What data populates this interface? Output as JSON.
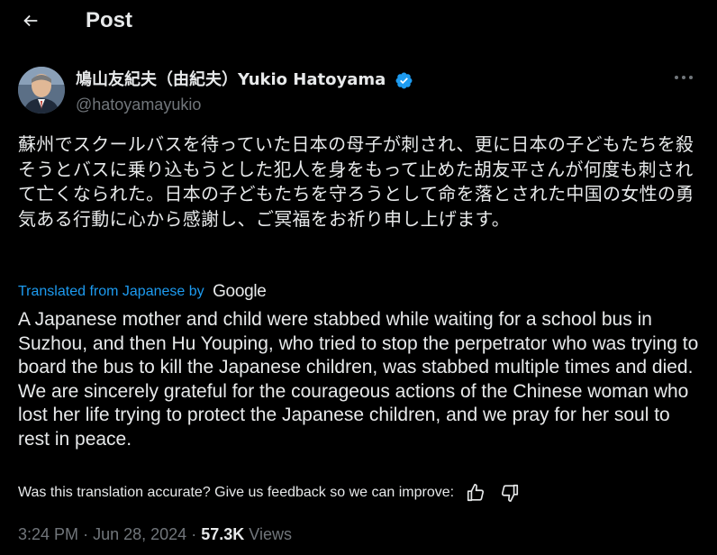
{
  "header": {
    "title": "Post"
  },
  "author": {
    "display_name": "鳩山友紀夫（由紀夫）Yukio Hatoyama",
    "handle": "@hatoyamayukio",
    "verified": true
  },
  "post": {
    "text_original": "蘇州でスクールバスを待っていた日本の母子が刺され、更に日本の子どもたちを殺そうとバスに乗り込もうとした犯人を身をもって止めた胡友平さんが何度も刺されて亡くなられた。日本の子どもたちを守ろうとして命を落とされた中国の女性の勇気ある行動に心から感謝し、ご冥福をお祈り申し上げます。",
    "translation_label": "Translated from Japanese by",
    "translation_provider": "Google",
    "text_translated": "A Japanese mother and child were stabbed while waiting for a school bus in Suzhou, and then Hu Youping, who tried to stop the perpetrator who was trying to board the bus to kill the Japanese children, was stabbed multiple times and died. We are sincerely grateful for the courageous actions of the Chinese woman who lost her life trying to protect the Japanese children, and we pray for her soul to rest in peace.",
    "feedback_prompt": "Was this translation accurate? Give us feedback so we can improve:"
  },
  "meta": {
    "time": "3:24 PM",
    "separator": "·",
    "date": "Jun 28, 2024",
    "views_count": "57.3K",
    "views_label": "Views"
  },
  "icons": {
    "back": "arrow-left-icon",
    "more": "more-horizontal-icon",
    "verified": "verified-badge-icon",
    "thumbs_up": "thumbs-up-icon",
    "thumbs_down": "thumbs-down-icon"
  },
  "colors": {
    "background": "#000000",
    "text_primary": "#e7e9ea",
    "text_secondary": "#71767b",
    "accent": "#1d9bf0"
  }
}
